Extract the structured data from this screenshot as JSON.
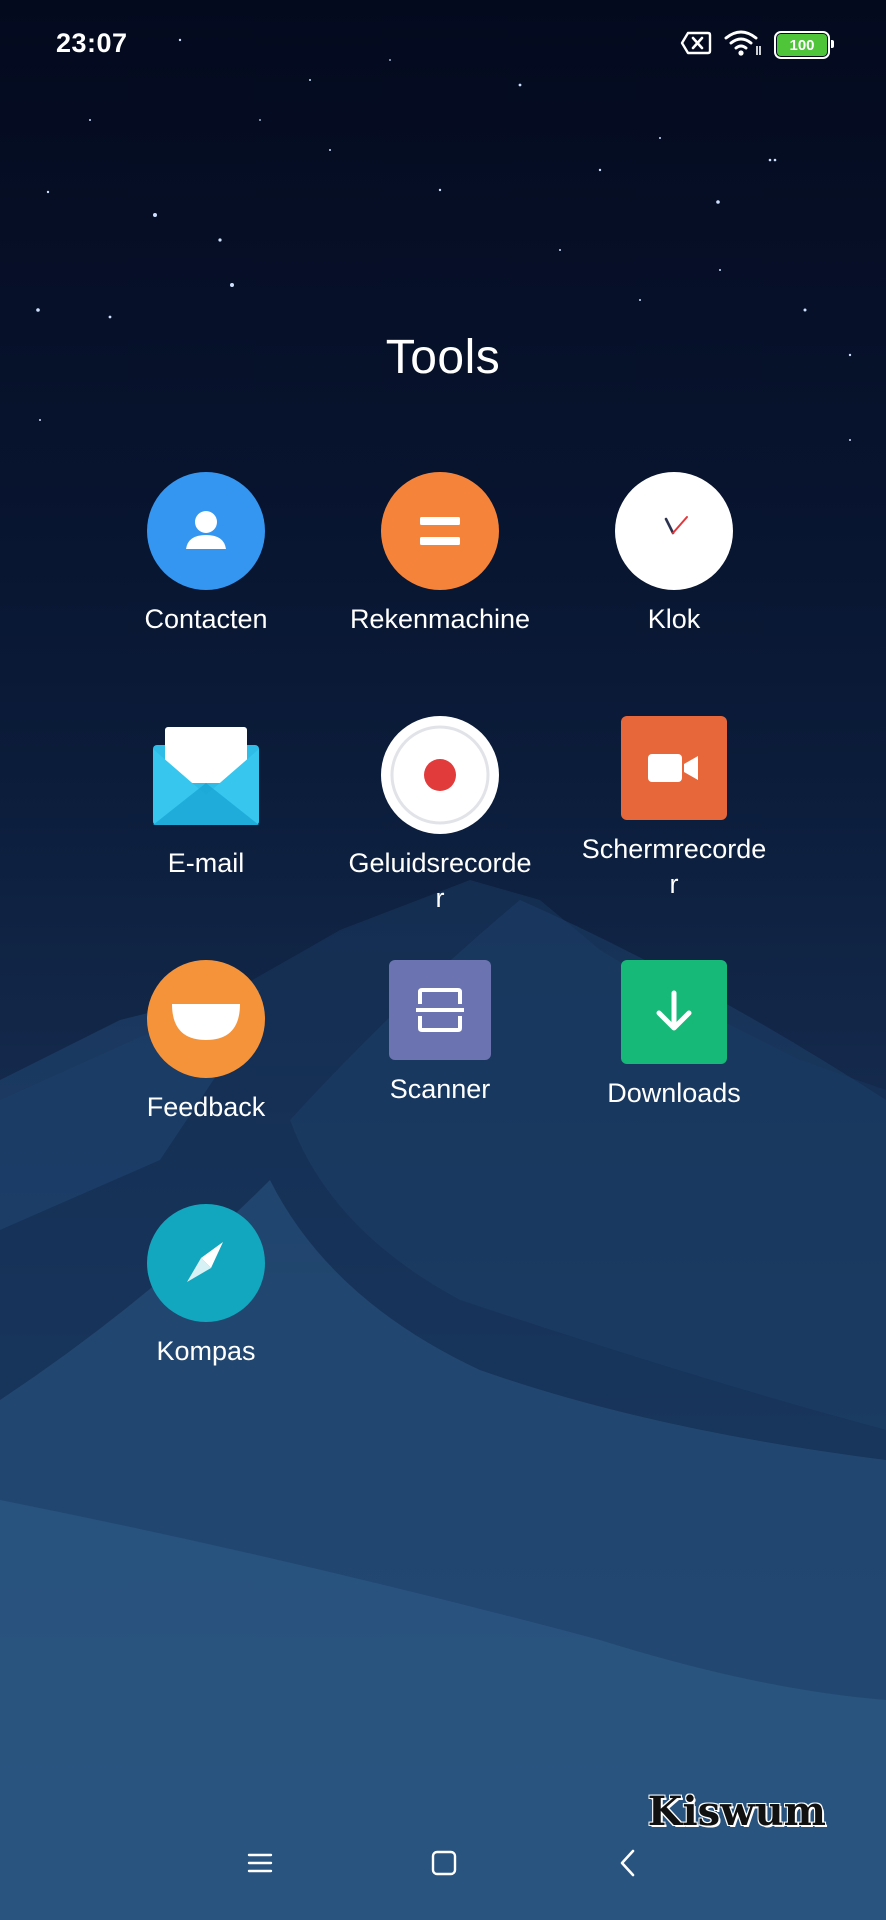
{
  "status_bar": {
    "time": "23:07",
    "battery_level": "100",
    "icons": [
      "sim-missing-icon",
      "wifi-icon",
      "battery-icon"
    ]
  },
  "folder": {
    "title": "Tools",
    "apps": [
      {
        "label": "Contacten",
        "icon": "contacts-icon",
        "color": "#3496f0"
      },
      {
        "label": "Rekenmachine",
        "icon": "calculator-icon",
        "color": "#f5843a"
      },
      {
        "label": "Klok",
        "icon": "clock-icon",
        "color": "#ffffff"
      },
      {
        "label": "E-mail",
        "icon": "email-icon",
        "color": "#2fbde8"
      },
      {
        "label": "Geluidsrecorder",
        "icon": "sound-recorder-icon",
        "color": "#e23b3b"
      },
      {
        "label": "Schermrecorder",
        "icon": "screen-recorder-icon",
        "color": "#e8673a"
      },
      {
        "label": "Feedback",
        "icon": "feedback-icon",
        "color": "#f5933a"
      },
      {
        "label": "Scanner",
        "icon": "scanner-icon",
        "color": "#6b73b0"
      },
      {
        "label": "Downloads",
        "icon": "downloads-icon",
        "color": "#17b978"
      },
      {
        "label": "Kompas",
        "icon": "compass-icon",
        "color": "#12a7be"
      }
    ]
  },
  "nav_bar": {
    "buttons": [
      "menu-icon",
      "home-icon",
      "back-icon"
    ]
  },
  "watermark": "Kiswum"
}
